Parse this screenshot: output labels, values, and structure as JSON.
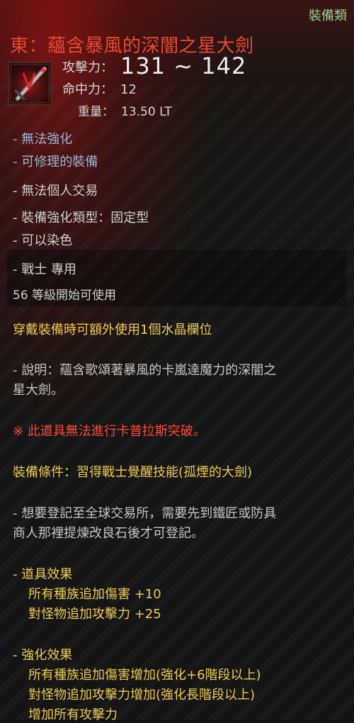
{
  "header": {
    "category": "裝備類",
    "item_name": "東：蘊含暴風的深闇之星大劍",
    "icon_name": "greatsword-item-icon"
  },
  "stats": {
    "attack_label": "攻擊力：",
    "attack_value": "131 ~ 142",
    "accuracy_label": "命中力：",
    "accuracy_value": "12",
    "weight_label": "重量：",
    "weight_value": "13.50 LT"
  },
  "properties": {
    "cannot_enhance": "- 無法強化",
    "repairable": "- 可修理的裝備",
    "no_personal_trade": "- 無法個人交易",
    "enhance_type": "- 裝備強化類型：固定型",
    "dyeable": "- 可以染色",
    "class_only": "- 戰士 專用",
    "level_req": "56 等級開始可使用"
  },
  "crystal_slot": "穿戴裝備時可額外使用1個水晶欄位",
  "description": {
    "line1": "- 說明：蘊含歌頌著暴風的卡嵐達魔力的深闇之",
    "line2": "星大劍。"
  },
  "warning": "※ 此道具無法進行卡普拉斯突破。",
  "equip_condition": "裝備條件：習得戰士覺醒技能(孤煙的大劍)",
  "market_note": {
    "line1": "- 想要登記至全球交易所，需要先到鐵匠或防具",
    "line2": "商人那裡提煉改良石後才可登記。"
  },
  "item_effects": {
    "header": "- 道具效果",
    "effects": [
      "所有種族追加傷害 +10",
      "對怪物追加攻擊力 +25"
    ]
  },
  "enhance_effects": {
    "header": "- 強化效果",
    "effects": [
      "所有種族追加傷害增加(強化+6階段以上)",
      "對怪物追加攻擊力增加(強化長階段以上)",
      "增加所有攻擊力"
    ]
  },
  "colors": {
    "title": "#e8492f",
    "category": "#9fd08a",
    "blue_text": "#9eb6d8",
    "yellow_text": "#f2cf53",
    "red_text": "#ff4a38"
  }
}
